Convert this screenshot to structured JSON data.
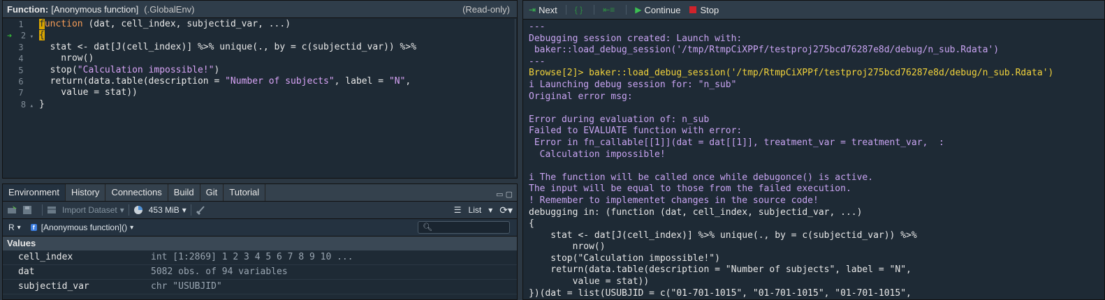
{
  "editor": {
    "label": "Function:",
    "name": "[Anonymous function]",
    "env": "(.GlobalEnv)",
    "readonly": "(Read-only)",
    "lines": [
      {
        "n": "1",
        "segs": [
          {
            "t": "f",
            "c": "hl"
          },
          {
            "t": "unction",
            "c": "kw"
          },
          {
            "t": " (dat, cell_index, subjectid_var, ...)",
            "c": ""
          }
        ]
      },
      {
        "n": "2",
        "arrow": true,
        "fold": true,
        "segs": [
          {
            "t": "{",
            "c": "hl"
          }
        ]
      },
      {
        "n": "3",
        "segs": [
          {
            "t": "  stat <- dat[J(cell_index)] %>% unique(., by = c(subjectid_var)) %>%",
            "c": ""
          }
        ]
      },
      {
        "n": "4",
        "segs": [
          {
            "t": "    nrow()",
            "c": ""
          }
        ]
      },
      {
        "n": "5",
        "segs": [
          {
            "t": "  stop(",
            "c": ""
          },
          {
            "t": "\"Calculation impossible!\"",
            "c": "str"
          },
          {
            "t": ")",
            "c": ""
          }
        ]
      },
      {
        "n": "6",
        "segs": [
          {
            "t": "  return(data.table(description = ",
            "c": ""
          },
          {
            "t": "\"Number of subjects\"",
            "c": "str"
          },
          {
            "t": ", label = ",
            "c": ""
          },
          {
            "t": "\"N\"",
            "c": "str"
          },
          {
            "t": ",",
            "c": ""
          }
        ]
      },
      {
        "n": "7",
        "segs": [
          {
            "t": "    value = stat))",
            "c": ""
          }
        ]
      },
      {
        "n": "8",
        "fold": true,
        "segs": [
          {
            "t": "}",
            "c": ""
          }
        ]
      }
    ]
  },
  "env_tabs": [
    "Environment",
    "History",
    "Connections",
    "Build",
    "Git",
    "Tutorial"
  ],
  "toolbar": {
    "import": "Import Dataset",
    "memory": "453 MiB",
    "view": "List"
  },
  "scope": {
    "lang": "R",
    "fn": "[Anonymous function]()",
    "badge": "f"
  },
  "values": {
    "header": "Values",
    "rows": [
      {
        "name": "cell_index",
        "value": "int [1:2869] 1 2 3 4 5 6 7 8 9 10 ..."
      },
      {
        "name": "dat",
        "value": "5082 obs. of 94 variables"
      },
      {
        "name": "subjectid_var",
        "value": "chr \"USUBJID\""
      }
    ]
  },
  "debug": {
    "next": "Next",
    "continue": "Continue",
    "stop": "Stop"
  },
  "console": [
    {
      "t": "---",
      "c": "pu"
    },
    {
      "t": "Debugging session created: Launch with:",
      "c": "pu"
    },
    {
      "t": " baker::load_debug_session('/tmp/RtmpCiXPPf/testproj275bcd76287e8d/debug/n_sub.Rdata')",
      "c": "pu"
    },
    {
      "t": "---",
      "c": "pu"
    },
    {
      "t": "Browse[2]> baker::load_debug_session('/tmp/RtmpCiXPPf/testproj275bcd76287e8d/debug/n_sub.Rdata')",
      "c": "yl"
    },
    {
      "t": "i Launching debug session for: \"n_sub\"",
      "c": "pu"
    },
    {
      "t": "Original error msg:",
      "c": "pu"
    },
    {
      "t": "",
      "c": "pu"
    },
    {
      "t": "Error during evaluation of: n_sub",
      "c": "pu"
    },
    {
      "t": "Failed to EVALUATE function with error:",
      "c": "pu"
    },
    {
      "t": " Error in fn_callable[[1]](dat = dat[[1]], treatment_var = treatment_var,  :",
      "c": "pu"
    },
    {
      "t": "  Calculation impossible!",
      "c": "pu"
    },
    {
      "t": "",
      "c": "pu"
    },
    {
      "t": "i The function will be called once while debugonce() is active.",
      "c": "pu"
    },
    {
      "t": "The input will be equal to those from the failed execution.",
      "c": "pu"
    },
    {
      "t": "! Remember to implementet changes in the source code!",
      "c": "pu"
    },
    {
      "t": "debugging in: (function (dat, cell_index, subjectid_var, ...)",
      "c": "wh"
    },
    {
      "t": "{",
      "c": "wh"
    },
    {
      "t": "    stat <- dat[J(cell_index)] %>% unique(., by = c(subjectid_var)) %>%",
      "c": "wh"
    },
    {
      "t": "        nrow()",
      "c": "wh"
    },
    {
      "t": "    stop(\"Calculation impossible!\")",
      "c": "wh"
    },
    {
      "t": "    return(data.table(description = \"Number of subjects\", label = \"N\",",
      "c": "wh"
    },
    {
      "t": "        value = stat))",
      "c": "wh"
    },
    {
      "t": "})(dat = list(USUBJID = c(\"01-701-1015\", \"01-701-1015\", \"01-701-1015\",",
      "c": "wh"
    }
  ]
}
